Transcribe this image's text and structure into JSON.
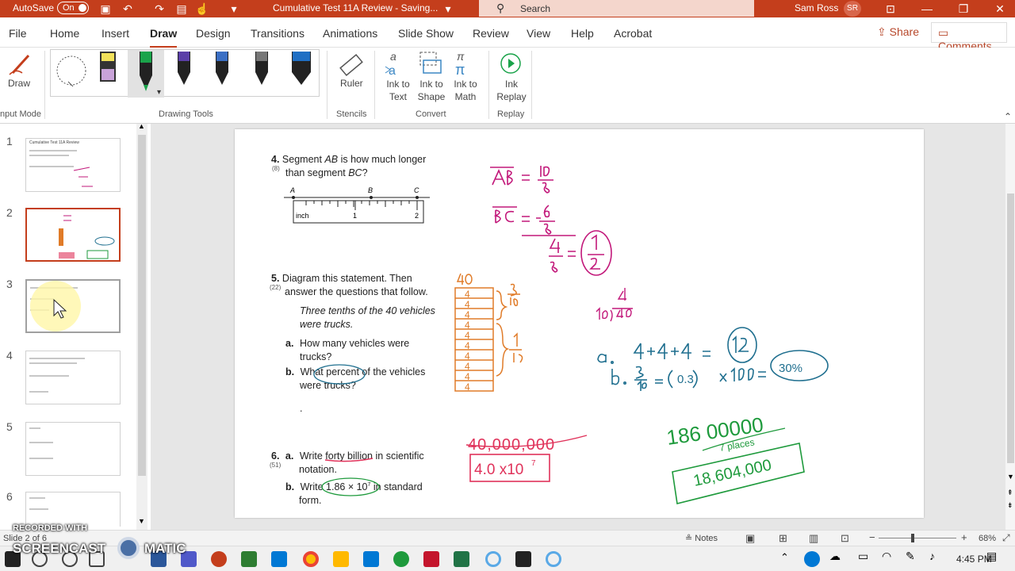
{
  "titlebar": {
    "autosave_label": "AutoSave",
    "autosave_state": "On",
    "doc_title": "Cumulative Test 11A Review - Saving...",
    "search_placeholder": "Search",
    "user_name": "Sam Ross",
    "user_initials": "SR",
    "accent": "#c43e1c"
  },
  "menu": {
    "tabs": [
      "File",
      "Home",
      "Insert",
      "Draw",
      "Design",
      "Transitions",
      "Animations",
      "Slide Show",
      "Review",
      "View",
      "Help",
      "Acrobat"
    ],
    "active": "Draw",
    "share_label": "Share",
    "comments_label": "Comments"
  },
  "ribbon": {
    "draw_label": "Draw",
    "input_mode_label": "nput Mode",
    "drawing_tools_label": "Drawing Tools",
    "ruler_label": "Ruler",
    "stencils_label": "Stencils",
    "ink_to_text_label": "Ink to Text",
    "ink_to_shape_label": "Ink to Shape",
    "ink_to_math_label": "Ink to Math",
    "convert_label": "Convert",
    "ink_replay_label": "Ink Replay",
    "replay_label": "Replay",
    "pens": [
      {
        "name": "lasso",
        "color": "#555555"
      },
      {
        "name": "highlighter-yellow",
        "color": "#f2e15a"
      },
      {
        "name": "pen-green",
        "color": "#1aa34a"
      },
      {
        "name": "pen-galaxy",
        "color": "#5b3fa8"
      },
      {
        "name": "pen-galaxy-2",
        "color": "#3b6fc4"
      },
      {
        "name": "pen-black",
        "color": "#222222"
      },
      {
        "name": "pen-blue",
        "color": "#1f6fc4"
      }
    ]
  },
  "slides": {
    "numbers": [
      "1",
      "2",
      "3",
      "4",
      "5",
      "6"
    ],
    "thumb_title": "Cumulative Test 11A Review",
    "selected": "2"
  },
  "slide": {
    "q4": {
      "num": "4.",
      "ref": "(8)",
      "text_a": "Segment ",
      "ab": "AB",
      "text_b": " is how much longer",
      "text_c": "than segment ",
      "bc": "BC",
      "text_d": "?",
      "ruler_unit": "inch",
      "ruler_1": "1",
      "ruler_2": "2",
      "point_a": "A",
      "point_b": "B",
      "point_c": "C"
    },
    "q5": {
      "num": "5.",
      "ref": "(22)",
      "line1": "Diagram this statement. Then",
      "line2": "answer the questions that follow.",
      "stmt1": "Three tenths of the 40 vehicles",
      "stmt2": "were trucks.",
      "a_label": "a.",
      "a_text1": "How many vehicles were",
      "a_text2": "trucks?",
      "b_label": "b.",
      "b_text1a": "What ",
      "b_text1b": "percent",
      "b_text1c": " of the vehicles",
      "b_text2": "were trucks?",
      "dot": "."
    },
    "q6": {
      "num": "6.",
      "ref": "(51)",
      "a_label": "a.",
      "a_text1a": "Write ",
      "a_text1b": "forty billion",
      "a_text1c": " in scientific",
      "a_text2": "notation.",
      "b_label": "b.",
      "b_text1a": "Write ",
      "b_text1b": "1.86 × 10",
      "b_exp": "7",
      "b_text1c": " in standard",
      "b_text2": "form."
    },
    "ink": {
      "ab": "AB = 10/8",
      "bc": "BC = -6/8",
      "diff": "4/8 = 1/2",
      "n40": "40",
      "frac310": "3/10",
      "frac110": "1/10",
      "division": "4 over 10)40",
      "line_a": "a. 4+4+4 = 12",
      "line_b": "b. 3/10 = (0.3) x 100 = 30%",
      "big_num": "40,000,000",
      "sci": "4.0 x 10^7",
      "std1": "186 00000",
      "places": "7 places",
      "std2": "18,604,000",
      "magenta": "#c2187a",
      "orange": "#e07b28",
      "blue": "#1f6f8f",
      "green": "#1e9a3c",
      "red": "#e0325a"
    }
  },
  "status": {
    "slide_info": "Slide 2 of 6",
    "notes_label": "Notes",
    "zoom": "68%",
    "zoom_fraction": 0.42
  },
  "taskbar": {
    "time": "4:45 PM"
  },
  "watermark": {
    "line1": "RECORDED WITH",
    "line2": "SCREENCAST",
    "line3": "MATIC"
  }
}
